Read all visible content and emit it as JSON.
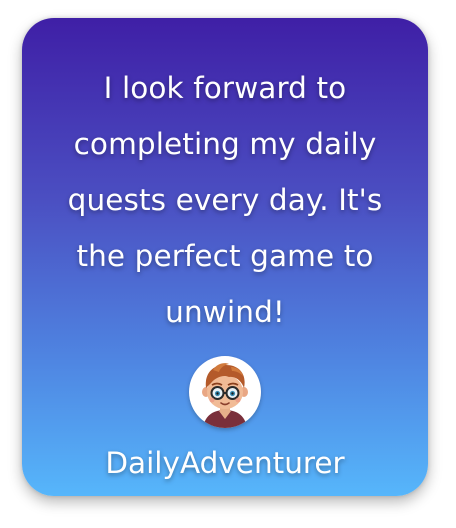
{
  "testimonial": {
    "quote": "I look forward to completing my daily quests every day. It's the perfect game to unwind!",
    "username": "DailyAdventurer",
    "avatar_icon": "cartoon-boy-with-glasses-avatar"
  },
  "colors": {
    "gradient_top": "#3f1fa6",
    "gradient_bottom": "#56b6fb",
    "text": "#ffffff"
  }
}
